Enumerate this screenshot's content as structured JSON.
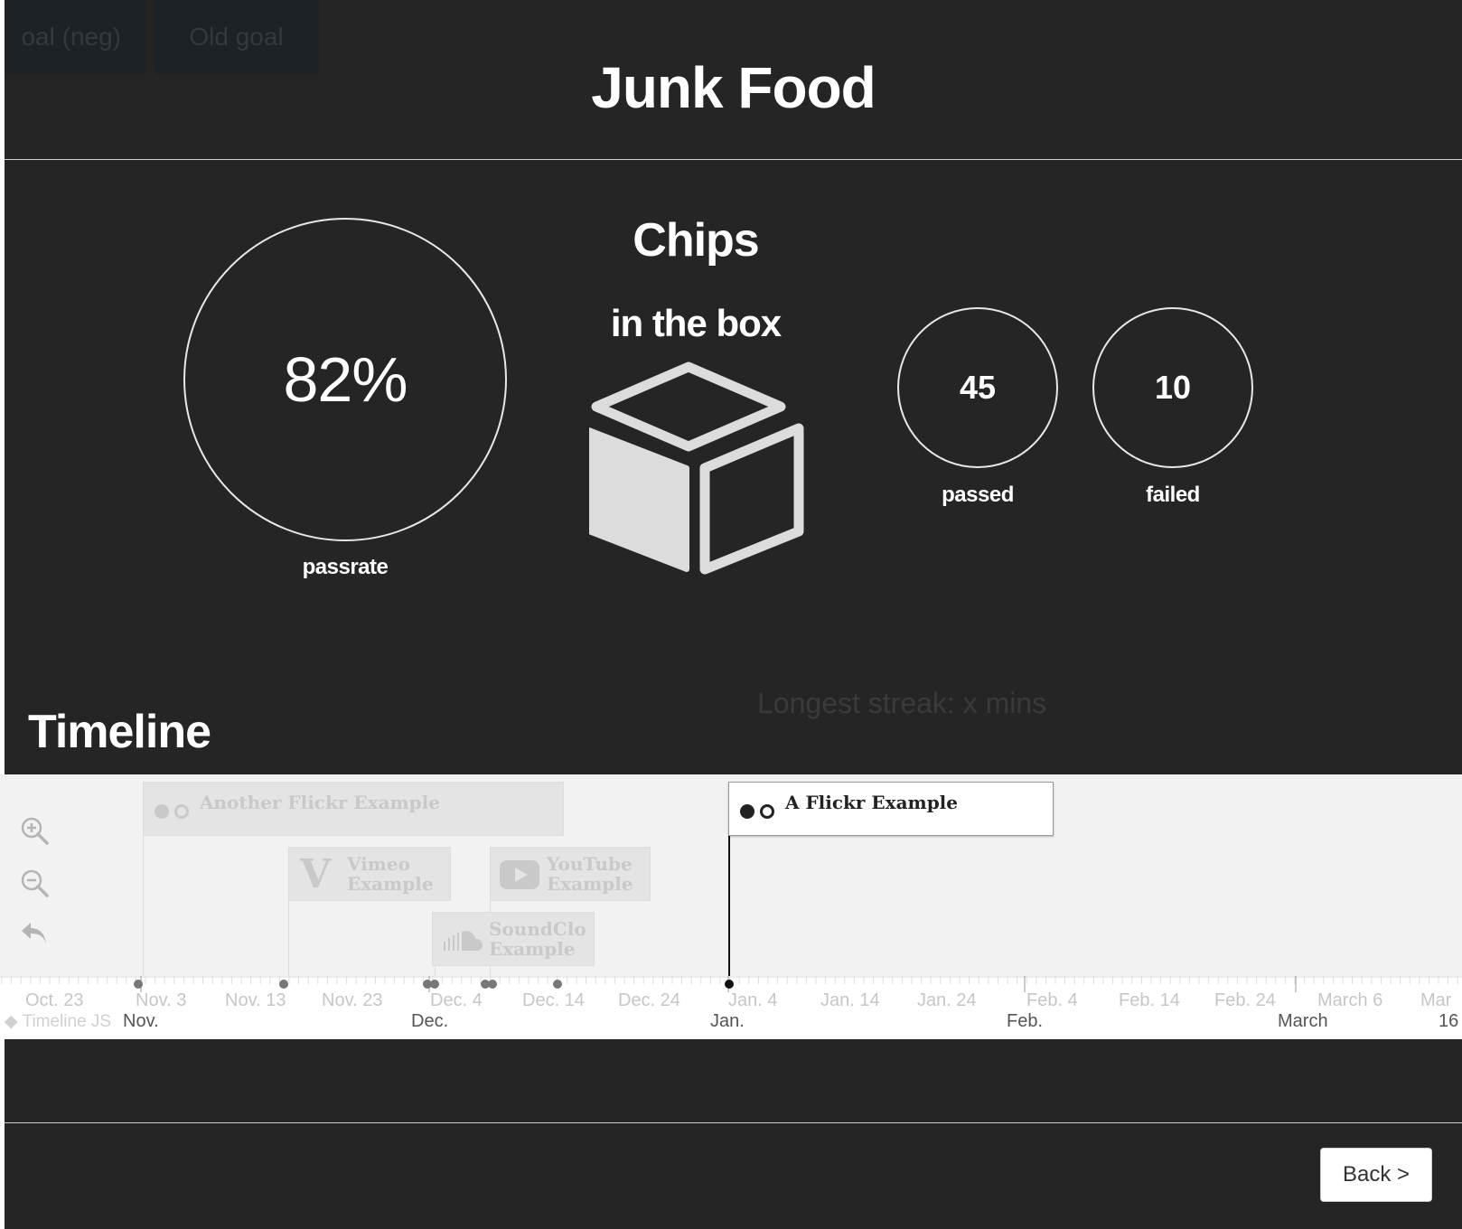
{
  "tabs": [
    {
      "label": "oal (neg)"
    },
    {
      "label": "Old goal"
    }
  ],
  "page_title": "Junk Food",
  "stats": {
    "passrate_value": "82%",
    "passrate_label": "passrate",
    "passed_value": "45",
    "passed_label": "passed",
    "failed_value": "10",
    "failed_label": "failed"
  },
  "habit": {
    "name": "Chips",
    "status": "in the box",
    "icon": "box-icon"
  },
  "streak_text": "Longest streak: x mins",
  "timeline": {
    "heading": "Timeline",
    "brand": "Timeline JS",
    "events": [
      {
        "title": "Another Flickr Example",
        "icon": "flickr-icon",
        "active": false
      },
      {
        "title": "Vimeo Example",
        "line1": "Vimeo",
        "line2": "Example",
        "icon": "vimeo-icon",
        "active": false
      },
      {
        "title": "YouTube Example",
        "line1": "YouTube",
        "line2": "Example",
        "icon": "youtube-icon",
        "active": false
      },
      {
        "title": "SoundCloud Example",
        "line1": "SoundClo",
        "line2": "Example",
        "icon": "soundcloud-icon",
        "active": false
      },
      {
        "title": "A Flickr Example",
        "icon": "flickr-icon",
        "active": true
      }
    ],
    "tick_labels": [
      "Oct. 23",
      "Nov. 3",
      "Nov. 13",
      "Nov. 23",
      "Dec. 4",
      "Dec. 14",
      "Dec. 24",
      "Jan. 4",
      "Jan. 14",
      "Jan. 24",
      "Feb. 4",
      "Feb. 14",
      "Feb. 24",
      "March 6",
      "Mar"
    ],
    "major_labels": [
      "Nov.",
      "Dec.",
      "Jan.",
      "Feb.",
      "March",
      "16"
    ],
    "tools": [
      "zoom-in-icon",
      "zoom-out-icon",
      "back-to-start-icon"
    ]
  },
  "back_button": "Back >"
}
